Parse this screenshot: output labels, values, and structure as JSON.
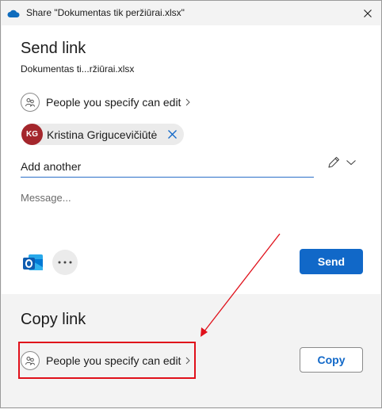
{
  "window": {
    "title": "Share \"Dokumentas tik peržiūrai.xlsx\""
  },
  "send_link": {
    "heading": "Send link",
    "filename": "Dokumentas ti...ržiūrai.xlsx",
    "permission_label": "People you specify can edit",
    "recipient": {
      "initials": "KG",
      "name": "Kristina Grigucevičiūtė"
    },
    "add_placeholder": "Add another",
    "message_placeholder": "Message...",
    "send_label": "Send"
  },
  "copy_link": {
    "heading": "Copy link",
    "permission_label": "People you specify can edit",
    "copy_label": "Copy"
  },
  "colors": {
    "accent": "#1168c8",
    "avatar": "#a4262c",
    "annotation": "#e0101a"
  }
}
